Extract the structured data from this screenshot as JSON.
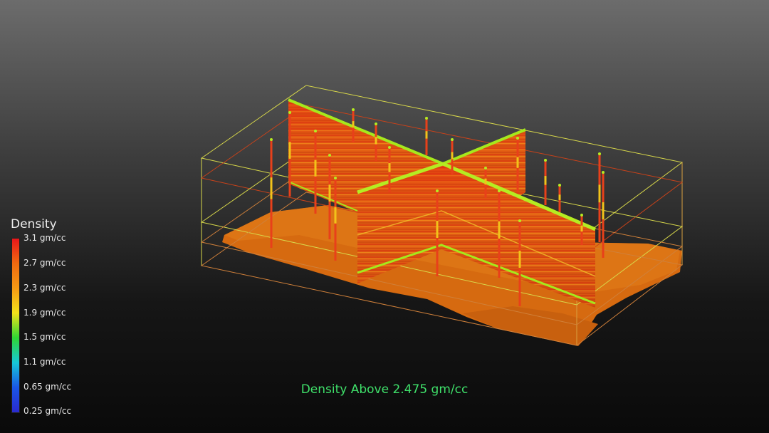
{
  "legend": {
    "title": "Density",
    "ticks": [
      "3.1 gm/cc",
      "2.7 gm/cc",
      "2.3 gm/cc",
      "1.9 gm/cc",
      "1.5 gm/cc",
      "1.1 gm/cc",
      "0.65 gm/cc",
      "0.25 gm/cc"
    ],
    "gradient_colors": [
      "#e8161b",
      "#f26a10",
      "#f79a14",
      "#f2e21a",
      "#2fd634",
      "#17c8d8",
      "#1a56e6",
      "#2a2acf"
    ]
  },
  "caption": "Density Above 2.475 gm/cc",
  "colors": {
    "section": "#e64a10",
    "seam_green": "#a6e81c",
    "box_outline": "#d8d84a",
    "box_outline_red": "#c8421a",
    "shell": "#d26a10",
    "caption": "#3fe06a"
  }
}
